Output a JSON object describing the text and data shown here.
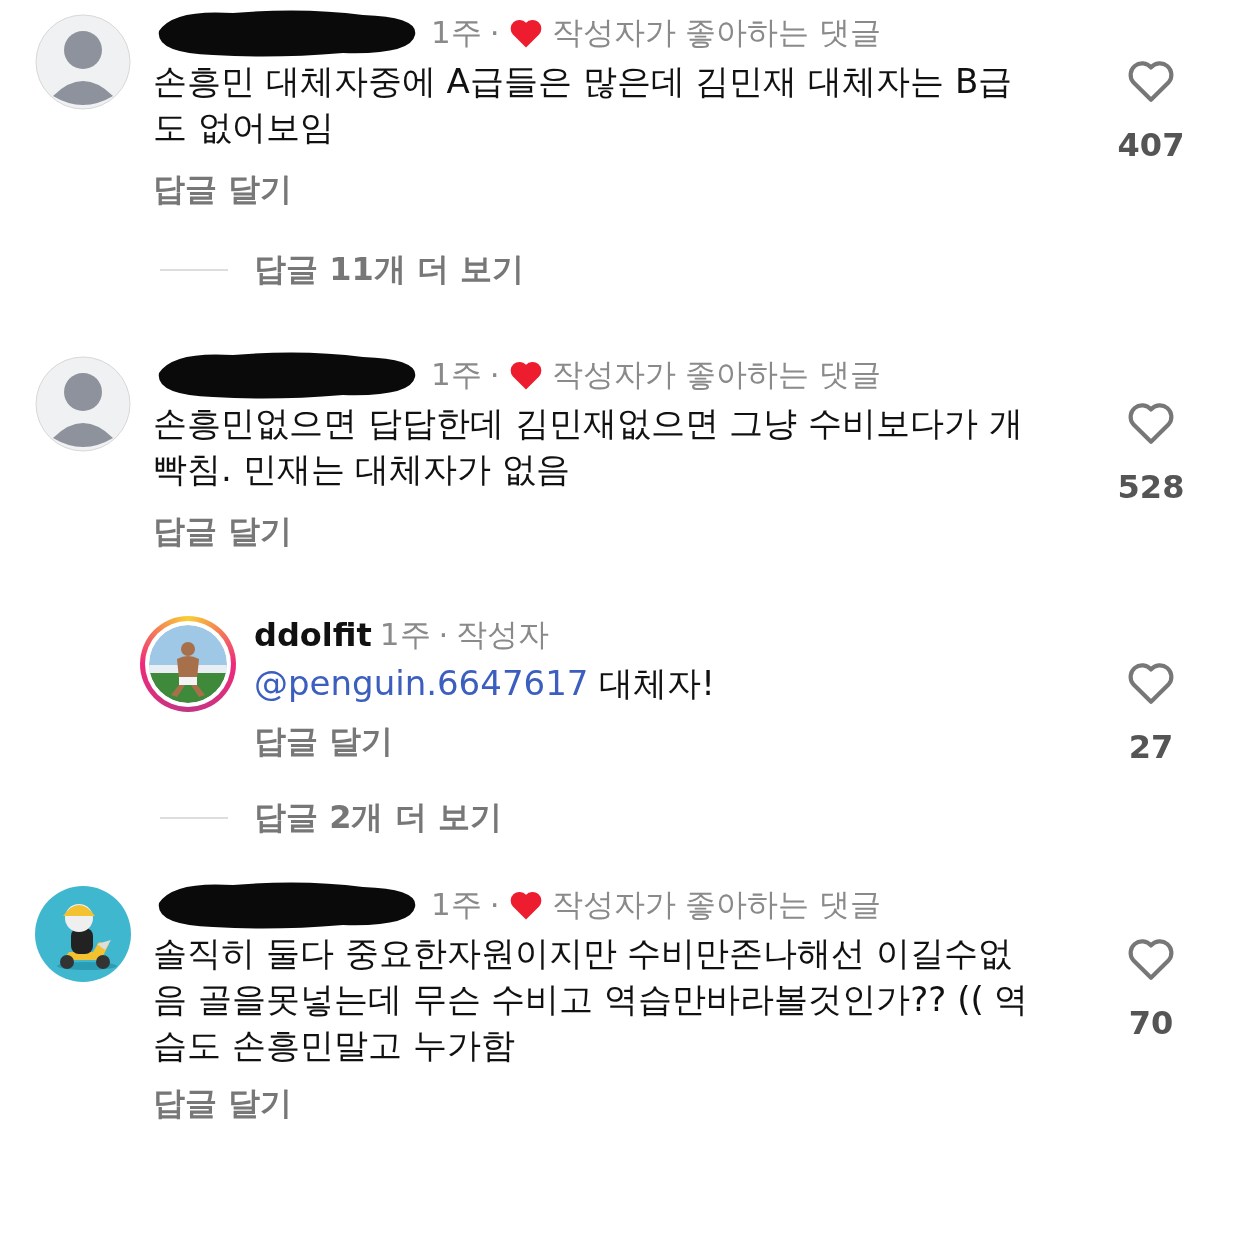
{
  "comments": [
    {
      "kind": "comment",
      "avatar": {
        "kind": "default"
      },
      "username_hidden": true,
      "time": "1주",
      "dot": "·",
      "author_liked": true,
      "liked_label": "작성자가 좋아하는 댓글",
      "text": "손흥민 대체자중에 A급들은 많은데 김민재 대체자는 B급도 없어보임",
      "likes": "407",
      "reply_label": "답글 달기",
      "more_replies": "답글 11개 더 보기"
    },
    {
      "kind": "comment",
      "avatar": {
        "kind": "default"
      },
      "username_hidden": true,
      "time": "1주",
      "dot": "·",
      "author_liked": true,
      "liked_label": "작성자가 좋아하는 댓글",
      "text": "손흥민없으면 답답한데 김민재없으면 그냥 수비보다가 개빡침. 민재는 대체자가 없음",
      "likes": "528",
      "reply_label": "답글 달기"
    },
    {
      "kind": "reply",
      "username_hidden": false,
      "username": "ddolfit",
      "time": "1주",
      "dot": "·",
      "badge": "작성자",
      "author_liked": false,
      "mention": "@penguin.6647617",
      "text": "대체자!",
      "likes": "27",
      "reply_label": "답글 달기",
      "more_replies": "답글 2개 더 보기"
    },
    {
      "kind": "comment",
      "avatar": {
        "kind": "cartoon"
      },
      "username_hidden": true,
      "time": "1주",
      "dot": "·",
      "author_liked": true,
      "liked_label": "작성자가 좋아하는 댓글",
      "text": "솔직히 둘다 중요한자원이지만 수비만존나해선 이길수없음 골을못넣는데 무슨 수비고 역습만바라볼것인가?? (( 역습도 손흥민말고 누가함",
      "likes": "70",
      "reply_label": "답글 달기"
    }
  ]
}
